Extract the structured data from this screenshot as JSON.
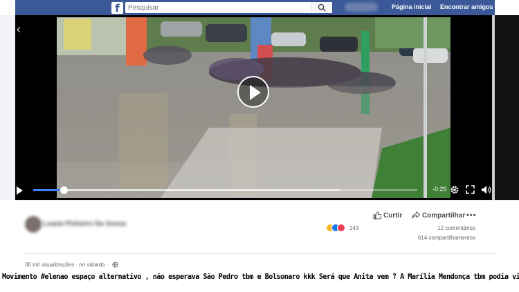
{
  "topbar": {
    "logo": "f",
    "search_placeholder": "Pesquisar",
    "nav_home": "Página inicial",
    "nav_friends": "Encontrar amigos"
  },
  "video": {
    "time_remaining": "-0:25",
    "progress": 0.08,
    "buffered": 0.8
  },
  "post": {
    "author": "Luana Pinheiro Da Souza",
    "like_label": "Curtir",
    "share_label": "Compartilhar",
    "reaction_count": "243",
    "comments": "12 comentários",
    "shares": "614 compartilhamentos",
    "views": "30 mil visualizações",
    "date": "no sábado"
  },
  "caption": "Movimento #elenao espaço alternativo , não esperava São Pedro tbm e Bolsonaro kkk Será que Anita vem ? A Marília Mendonça tbm podia vim",
  "colors": {
    "brand": "#3b5998",
    "progress": "#4080ff"
  }
}
